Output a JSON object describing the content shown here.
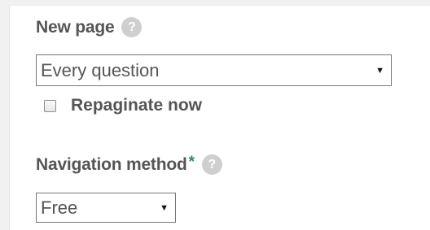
{
  "new_page": {
    "label": "New page",
    "help_icon": "question-mark-icon",
    "help_glyph": "?",
    "select_value": "Every question",
    "select_arrow": "▼",
    "repaginate_label": "Repaginate now",
    "repaginate_checked": false
  },
  "navigation": {
    "label": "Navigation method",
    "required_mark": "*",
    "help_icon": "question-mark-icon",
    "help_glyph": "?",
    "select_value": "Free",
    "select_arrow": "▼"
  },
  "colors": {
    "label_text": "#555555",
    "required_mark": "#2e8b57",
    "help_icon_bg": "#cfcfcf",
    "page_background": "#f1f1f1",
    "panel_background": "#ffffff"
  }
}
